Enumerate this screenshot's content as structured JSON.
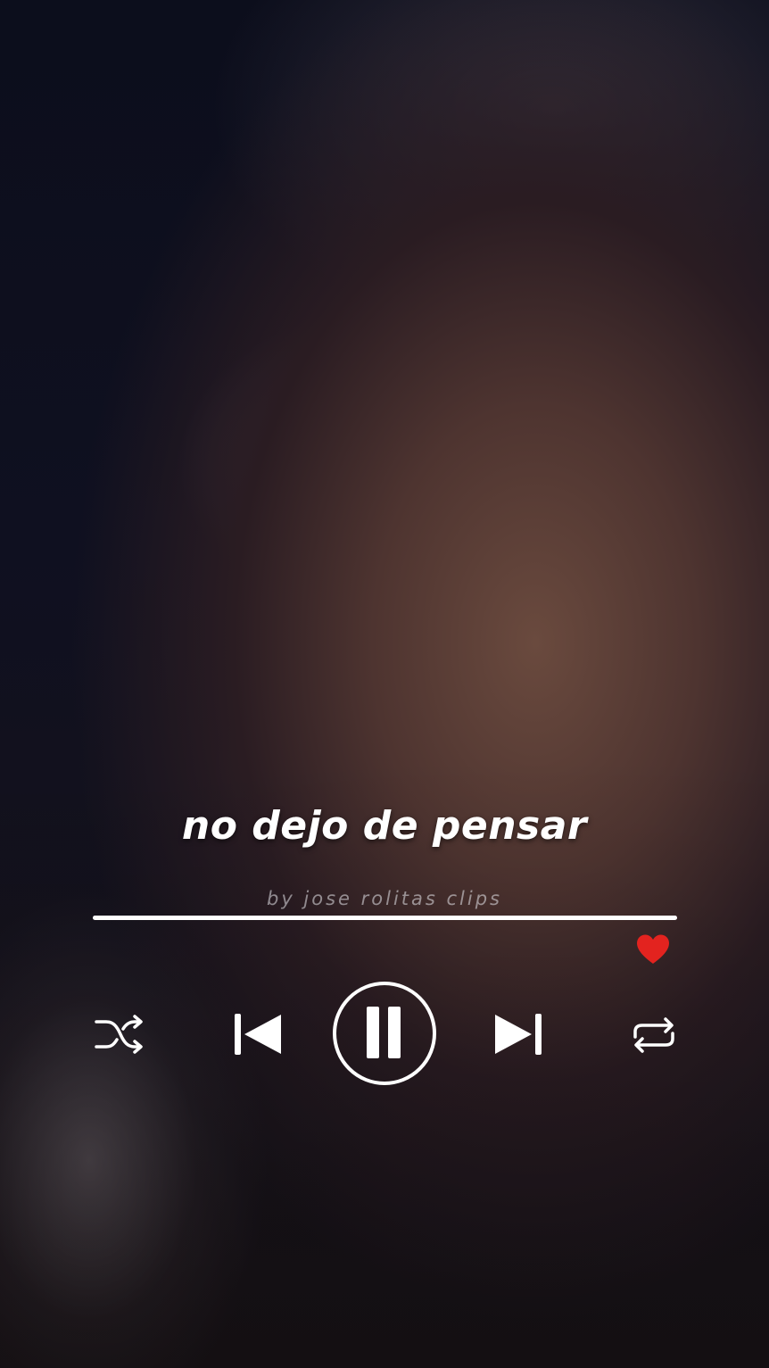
{
  "player": {
    "lyric": "no dejo de pensar",
    "credit": "by jose rolitas clips",
    "progress": 1.0,
    "liked": true
  },
  "colors": {
    "heart": "#e3231f",
    "text": "#ffffff",
    "track": "#ffffff"
  },
  "icons": {
    "shuffle": "shuffle-icon",
    "previous": "skip-previous-icon",
    "play_pause": "pause-icon",
    "next": "skip-next-icon",
    "repeat": "repeat-icon",
    "like": "heart-icon"
  }
}
